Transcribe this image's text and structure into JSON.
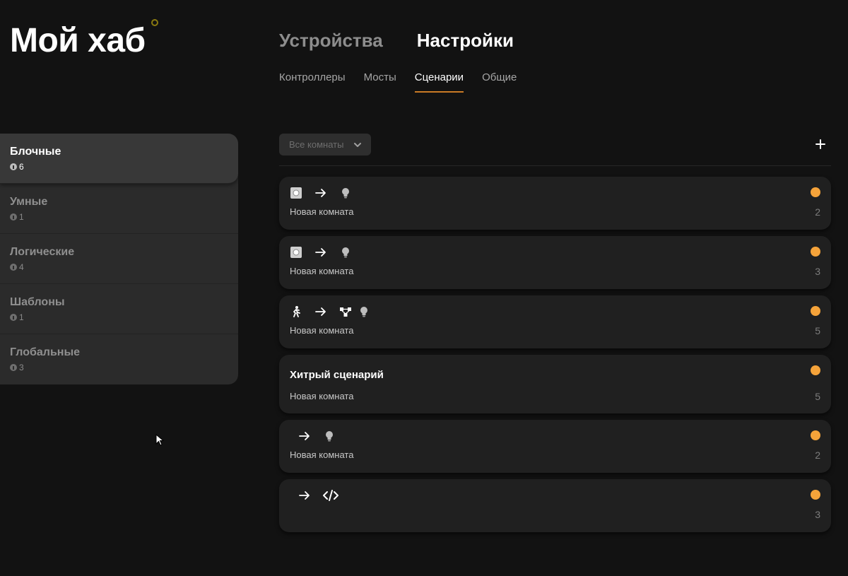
{
  "header": {
    "app_title": "Мой хаб",
    "section_tabs": [
      {
        "label": "Устройства",
        "active": false
      },
      {
        "label": "Настройки",
        "active": true
      }
    ],
    "sub_tabs": [
      {
        "label": "Контроллеры",
        "active": false
      },
      {
        "label": "Мосты",
        "active": false
      },
      {
        "label": "Сценарии",
        "active": true
      },
      {
        "label": "Общие",
        "active": false
      }
    ]
  },
  "sidebar": {
    "items": [
      {
        "label": "Блочные",
        "count": "6",
        "active": true
      },
      {
        "label": "Умные",
        "count": "1",
        "active": false
      },
      {
        "label": "Логические",
        "count": "4",
        "active": false
      },
      {
        "label": "Шаблоны",
        "count": "1",
        "active": false
      },
      {
        "label": "Глобальные",
        "count": "3",
        "active": false
      }
    ]
  },
  "toolbar": {
    "room_filter_label": "Все комнаты",
    "add_icon": "plus-icon"
  },
  "scenarios": [
    {
      "icons": [
        "button-icon",
        "arrow-right-icon",
        "lightbulb-icon"
      ],
      "name": "",
      "room": "Новая комната",
      "count": "2"
    },
    {
      "icons": [
        "button-icon",
        "arrow-right-icon",
        "lightbulb-icon"
      ],
      "name": "",
      "room": "Новая комната",
      "count": "3"
    },
    {
      "icons": [
        "motion-sensor-icon",
        "arrow-right-icon",
        "group-icon",
        "lightbulb-icon"
      ],
      "name": "",
      "room": "Новая комната",
      "count": "5"
    },
    {
      "icons": [],
      "name": "Хитрый сценарий",
      "room": "Новая комната",
      "count": "5"
    },
    {
      "icons": [
        "arrow-right-icon",
        "lightbulb-icon"
      ],
      "name": "",
      "room": "Новая комната",
      "count": "2"
    },
    {
      "icons": [
        "arrow-right-icon",
        "code-icon"
      ],
      "name": "",
      "room": "",
      "count": "3"
    }
  ],
  "colors": {
    "background": "#121212",
    "accent": "#c97a25",
    "status_dot": "#f5a33a"
  }
}
